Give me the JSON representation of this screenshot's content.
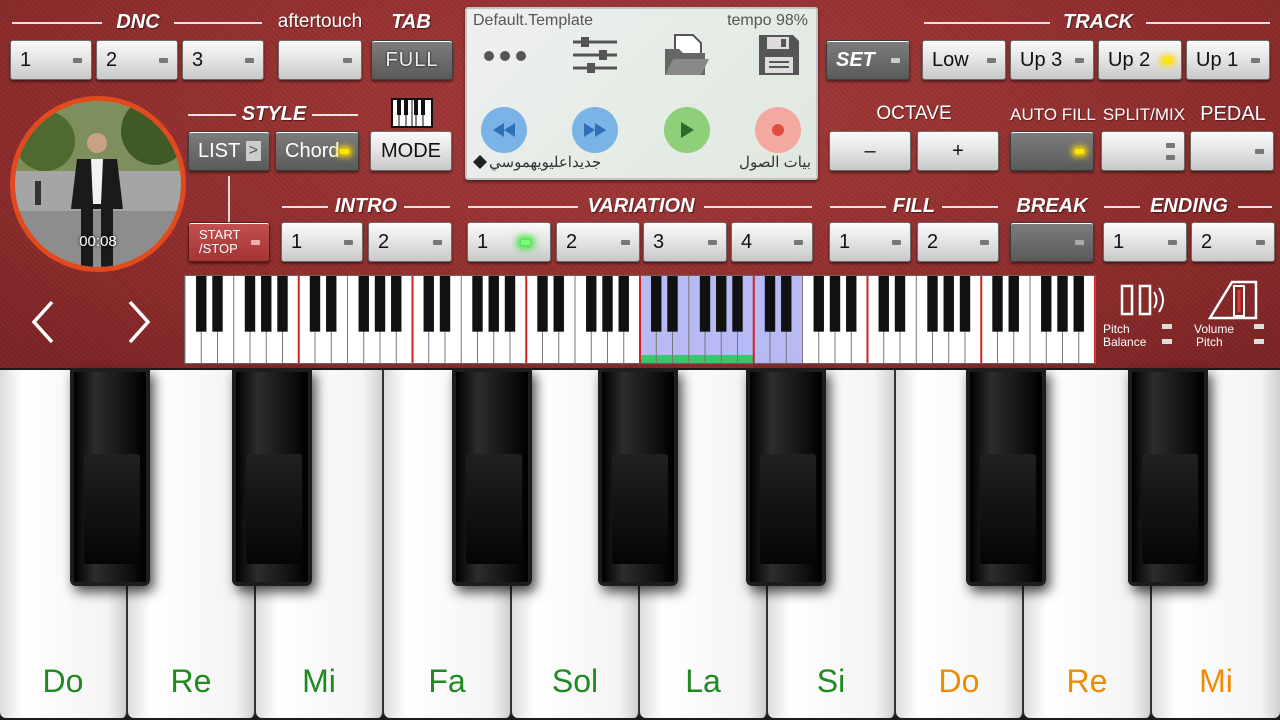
{
  "titles": {
    "dnc": "DNC",
    "aftertouch": "aftertouch",
    "tab": "TAB",
    "track": "TRACK",
    "style": "STYLE",
    "octave": "OCTAVE",
    "autofill": "AUTO FILL",
    "splitmix": "SPLIT/MIX",
    "pedal": "PEDAL",
    "intro": "INTRO",
    "variation": "VARIATION",
    "fill": "FILL",
    "break": "BREAK",
    "ending": "ENDING"
  },
  "dnc": {
    "b1": "1",
    "b2": "2",
    "b3": "3"
  },
  "tab": {
    "full": "FULL"
  },
  "track": {
    "set": "SET",
    "low": "Low",
    "up3": "Up 3",
    "up2": "Up 2",
    "up1": "Up 1"
  },
  "style": {
    "list": "LIST",
    "list_arrow": ">",
    "chord": "Chord",
    "mode": "MODE"
  },
  "octave": {
    "minus": "–",
    "plus": "+"
  },
  "display": {
    "template": "Default.Template",
    "tempo": "tempo 98%",
    "left_text": "جديداعليويهموسي",
    "right_text": "بيات الصول"
  },
  "video": {
    "time": "00:08"
  },
  "controls": {
    "start_stop_line1": "START",
    "start_stop_line2": "/STOP"
  },
  "intro": {
    "b1": "1",
    "b2": "2"
  },
  "variation": {
    "b1": "1",
    "b2": "2",
    "b3": "3",
    "b4": "4"
  },
  "fill": {
    "b1": "1",
    "b2": "2"
  },
  "ending": {
    "b1": "1",
    "b2": "2"
  },
  "nav": {
    "prev": "‹",
    "next": "›"
  },
  "side": {
    "pitch_balance_1": "Pitch",
    "pitch_balance_2": "Balance",
    "volume_pitch_1": "Volume",
    "volume_pitch_2": "Pitch"
  },
  "notes": [
    {
      "label": "Do",
      "color": "#1f8a1f"
    },
    {
      "label": "Re",
      "color": "#1f8a1f"
    },
    {
      "label": "Mi",
      "color": "#1f8a1f"
    },
    {
      "label": "Fa",
      "color": "#1f8a1f"
    },
    {
      "label": "Sol",
      "color": "#1f8a1f"
    },
    {
      "label": "La",
      "color": "#1f8a1f"
    },
    {
      "label": "Si",
      "color": "#1f8a1f"
    },
    {
      "label": "Do",
      "color": "#f08a00"
    },
    {
      "label": "Re",
      "color": "#f08a00"
    },
    {
      "label": "Mi",
      "color": "#f08a00"
    }
  ],
  "colors": {
    "panel": "#8e2b2b",
    "led_yellow": "#ffe600",
    "led_green": "#3de63d",
    "rewind": "#7ab3e6",
    "play": "#8fcf7a",
    "record": "#f3a8a0"
  }
}
